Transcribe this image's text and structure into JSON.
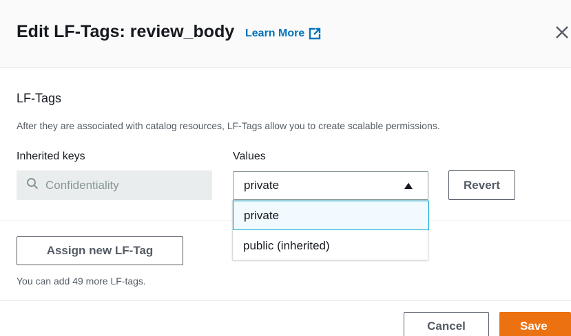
{
  "modal": {
    "title": "Edit LF-Tags: review_body",
    "learn_more": "Learn More"
  },
  "section": {
    "title": "LF-Tags",
    "description": "After they are associated with catalog resources, LF-Tags allow you to create scalable permissions."
  },
  "columns": {
    "keys_label": "Inherited keys",
    "values_label": "Values"
  },
  "tag_row": {
    "key_value": "Confidentiality",
    "selected_value": "private",
    "revert_label": "Revert"
  },
  "dropdown": {
    "options": [
      "private",
      "public (inherited)"
    ]
  },
  "assign": {
    "button_label": "Assign new LF-Tag",
    "hint": "You can add 49 more LF-tags."
  },
  "footer": {
    "cancel_label": "Cancel",
    "save_label": "Save"
  },
  "colors": {
    "link": "#0073bb",
    "primary": "#ec7211",
    "focus": "#00a1c9"
  },
  "icons": [
    "external-link-icon",
    "close-icon",
    "search-icon",
    "caret-up-icon"
  ]
}
